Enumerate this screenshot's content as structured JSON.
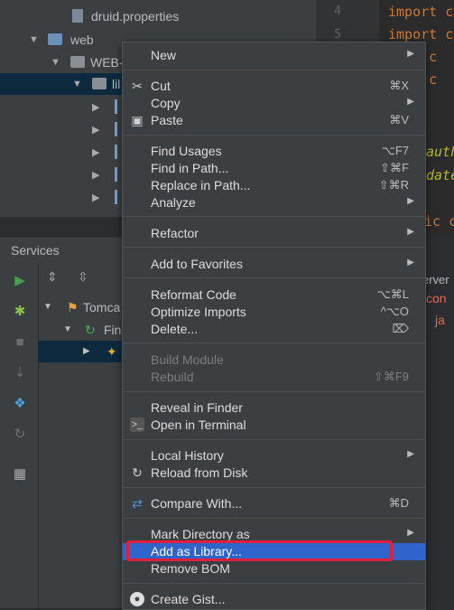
{
  "tree": {
    "druid_file": "druid.properties",
    "web_folder": "web",
    "webinf_folder": "WEB-",
    "lib_folder": "lil"
  },
  "editor": {
    "line_numbers": [
      "4",
      "5"
    ],
    "code_lines": [
      "import c",
      "import c",
      "rt c",
      "rt c"
    ],
    "annotations": [
      "auth",
      "date"
    ],
    "code_tail": "ic c",
    "log_text": "erver",
    "log_text2": "con",
    "log_text3": "ja"
  },
  "services": {
    "title": "Services",
    "tomcat_label": "Tomca",
    "fin_label": "Fin"
  },
  "menu": {
    "new": "New",
    "cut": "Cut",
    "cut_sc": "⌘X",
    "copy": "Copy",
    "paste": "Paste",
    "paste_sc": "⌘V",
    "find_usages": "Find Usages",
    "find_usages_sc": "⌥F7",
    "find_in_path": "Find in Path...",
    "find_in_path_sc": "⇧⌘F",
    "replace_in_path": "Replace in Path...",
    "replace_in_path_sc": "⇧⌘R",
    "analyze": "Analyze",
    "refactor": "Refactor",
    "add_to_favorites": "Add to Favorites",
    "reformat_code": "Reformat Code",
    "reformat_code_sc": "⌥⌘L",
    "optimize_imports": "Optimize Imports",
    "optimize_imports_sc": "^⌥O",
    "delete": "Delete...",
    "delete_sc": "⌦",
    "build_module": "Build Module",
    "rebuild": "Rebuild",
    "rebuild_sc": "⇧⌘F9",
    "reveal_in_finder": "Reveal in Finder",
    "open_in_terminal": "Open in Terminal",
    "local_history": "Local History",
    "reload_from_disk": "Reload from Disk",
    "compare_with": "Compare With...",
    "compare_with_sc": "⌘D",
    "mark_directory_as": "Mark Directory as",
    "add_as_library": "Add as Library...",
    "remove_bom": "Remove BOM",
    "create_gist": "Create Gist..."
  },
  "colors": {
    "highlight": "#2f65ca",
    "annotation_box": "#e0203b"
  }
}
